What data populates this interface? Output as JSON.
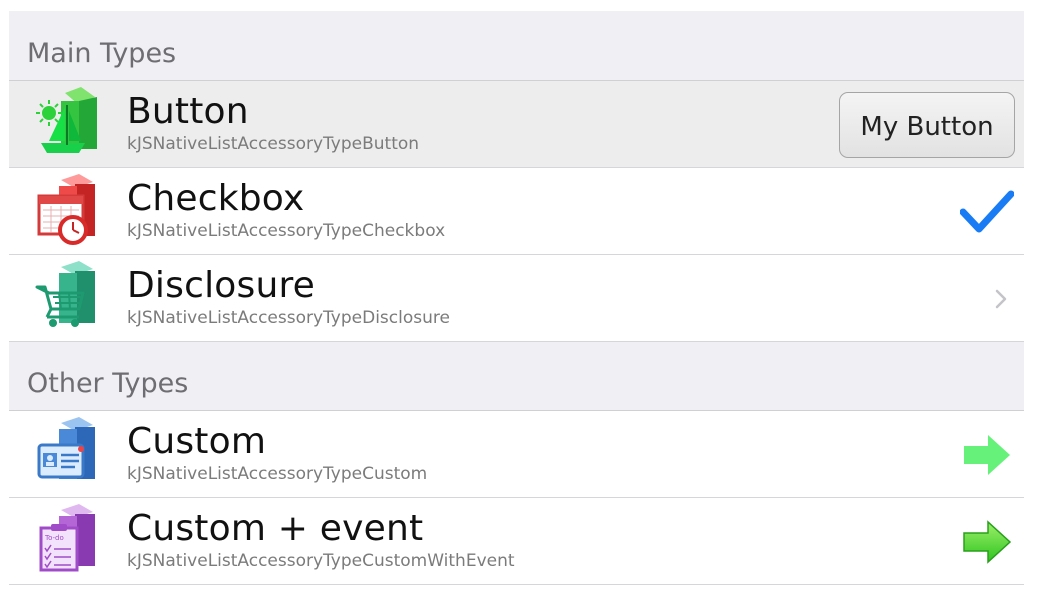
{
  "sections": [
    {
      "title": "Main Types",
      "rows": [
        {
          "title": "Button",
          "subtitle": "kJSNativeListAccessoryTypeButton",
          "icon": "sailboat-book-icon",
          "accessory": "button",
          "button_label": "My Button",
          "selected": true
        },
        {
          "title": "Checkbox",
          "subtitle": "kJSNativeListAccessoryTypeCheckbox",
          "icon": "calendar-clock-book-icon",
          "accessory": "checkmark"
        },
        {
          "title": "Disclosure",
          "subtitle": "kJSNativeListAccessoryTypeDisclosure",
          "icon": "shopping-cart-book-icon",
          "accessory": "chevron"
        }
      ]
    },
    {
      "title": "Other Types",
      "rows": [
        {
          "title": "Custom",
          "subtitle": "kJSNativeListAccessoryTypeCustom",
          "icon": "contact-card-book-icon",
          "accessory": "arrow-light-green"
        },
        {
          "title": "Custom + event",
          "subtitle": "kJSNativeListAccessoryTypeCustomWithEvent",
          "icon": "todo-list-book-icon",
          "accessory": "arrow-green"
        }
      ]
    }
  ],
  "colors": {
    "section_background": "#efeff4",
    "section_text": "#6d6d72",
    "checkmark": "#1a7cf5",
    "arrow_light_green": "#66f27a",
    "arrow_green": "#3fd92c"
  }
}
